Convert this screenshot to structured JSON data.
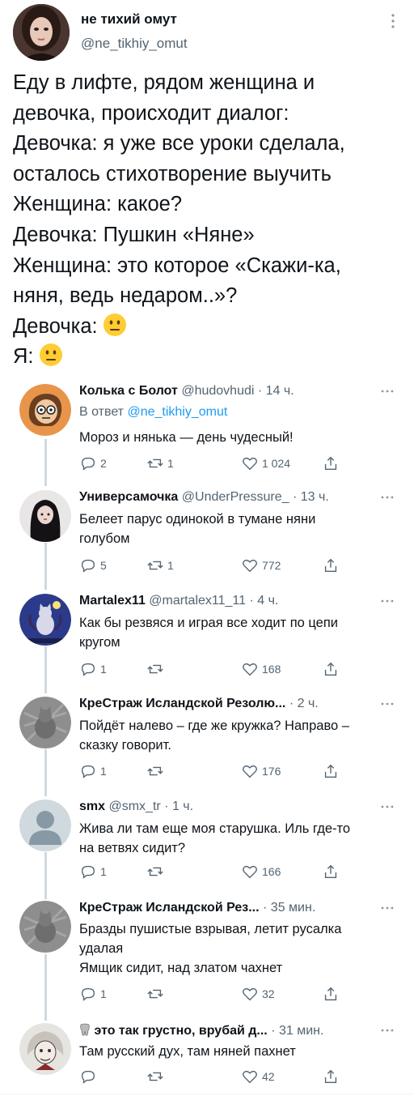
{
  "main_tweet": {
    "author_name": "не тихий омут",
    "author_handle": "@ne_tikhiy_omut",
    "text_lines": [
      "Еду в лифте, рядом женщина и",
      "девочка, происходит диалог:",
      "Девочка: я уже все уроки сделала,",
      "осталось стихотворение выучить",
      "Женщина: какое?",
      "Девочка: Пушкин «Няне»",
      "Женщина: это которое «Скажи-ка,",
      "няня, ведь недаром..»?",
      "Девочка:",
      "Я:"
    ],
    "emoji": "neutral-face-emoji"
  },
  "replies": [
    {
      "name": "Колька с Болот",
      "meta": "@hudovhudi · 14 ч.",
      "reply_to_prefix": "В ответ",
      "reply_to_handle": "@ne_tikhiy_omut",
      "text_lines": [
        "Мороз и нянька — день чудесный!"
      ],
      "replies": "2",
      "retweets": "1",
      "likes": "1 024"
    },
    {
      "name": "Универсамочка",
      "meta": "@UnderPressure_ · 13 ч.",
      "text_lines": [
        "Белеет парус одинокой в тумане няни",
        "голубом"
      ],
      "replies": "5",
      "retweets": "1",
      "likes": "772"
    },
    {
      "name": "Martalex11",
      "meta": "@martalex11_11 · 4 ч.",
      "text_lines": [
        "Как бы резвяся и играя все ходит по цепи",
        "кругом"
      ],
      "replies": "1",
      "retweets": "",
      "likes": "168"
    },
    {
      "name": "КреСтраж Исландской Резолю...",
      "meta": "· 2 ч.",
      "text_lines": [
        "Пойдёт налево – где же кружка? Направо –",
        "сказку говорит."
      ],
      "replies": "1",
      "retweets": "",
      "likes": "176"
    },
    {
      "name": "smx",
      "meta": "@smx_tr · 1 ч.",
      "text_lines": [
        "Жива ли там еще моя старушка. Иль где-то",
        "на ветвях сидит?"
      ],
      "replies": "1",
      "retweets": "",
      "likes": "166"
    },
    {
      "name": "КреСтраж Исландской Рез...",
      "meta": "· 35 мин.",
      "text_lines": [
        "Бразды пушистые взрывая, летит русалка",
        "удалая",
        "Ямщик сидит, над златом чахнет"
      ],
      "replies": "1",
      "retweets": "",
      "likes": "32"
    },
    {
      "name": "это так грустно, врубай д...",
      "meta": "· 31 мин.",
      "text_lines": [
        "Там русский дух, там няней пахнет"
      ],
      "replies": "",
      "retweets": "",
      "likes": "42"
    }
  ],
  "colors": {
    "text": "#0f1419",
    "secondary": "#536471",
    "link": "#1d9bf0",
    "thread_line": "#cfd9de"
  }
}
